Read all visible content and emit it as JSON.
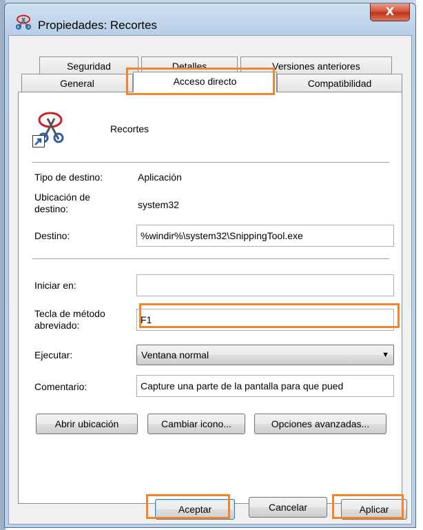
{
  "window": {
    "title": "Propiedades: Recortes",
    "close_label": "X"
  },
  "tabs": {
    "row1": [
      "Seguridad",
      "Detalles",
      "Versiones anteriores"
    ],
    "row2": [
      "General",
      "Acceso directo",
      "Compatibilidad"
    ],
    "active": "Acceso directo"
  },
  "shortcut": {
    "name": "Recortes",
    "target_type_label": "Tipo de destino:",
    "target_type": "Aplicación",
    "target_location_label": "Ubicación de destino:",
    "target_location": "system32",
    "target_label": "Destino:",
    "target": "%windir%\\system32\\SnippingTool.exe",
    "start_in_label": "Iniciar en:",
    "start_in": "",
    "hotkey_label": "Tecla de método abreviado:",
    "hotkey": "F1",
    "run_label": "Ejecutar:",
    "run": "Ventana normal",
    "comment_label": "Comentario:",
    "comment": "Capture una parte de la pantalla para que pued"
  },
  "buttons": {
    "open_location": "Abrir ubicación",
    "change_icon": "Cambiar icono...",
    "advanced": "Opciones avanzadas...",
    "ok": "Aceptar",
    "cancel": "Cancelar",
    "apply": "Aplicar"
  },
  "colors": {
    "highlight": "#f5832a",
    "title_bar": "#b8cfe7",
    "close_button": "#c0341c"
  },
  "icons": {
    "app": "scissors-icon",
    "shortcut_overlay": "shortcut-arrow-icon"
  }
}
